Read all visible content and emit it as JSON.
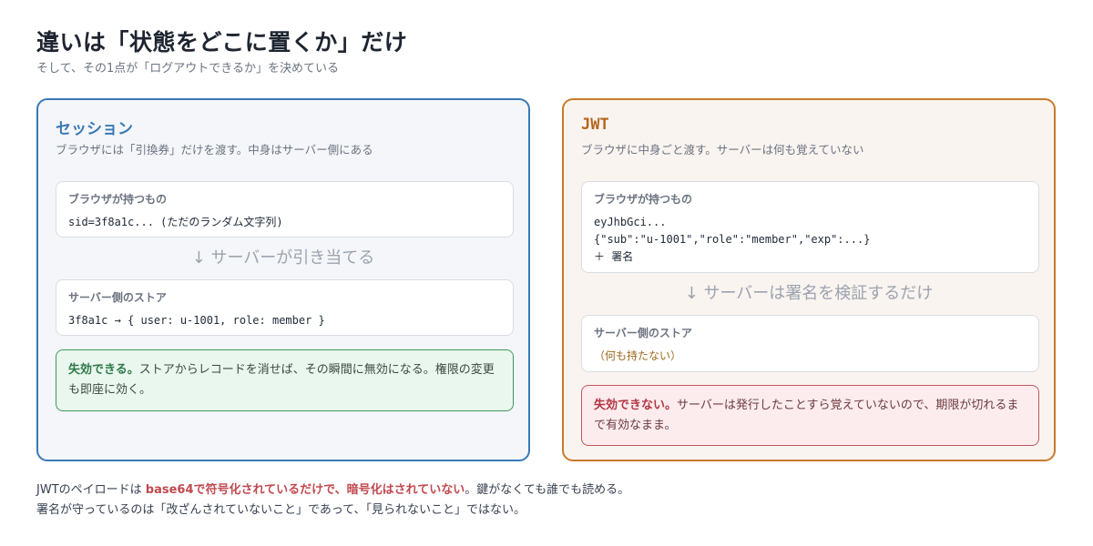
{
  "header": {
    "title": "違いは「状態をどこに置くか」だけ",
    "subtitle": "そして、その1点が「ログアウトできるか」を決めている"
  },
  "session": {
    "title": "セッション",
    "desc": "ブラウザには「引換券」だけを渡す。中身はサーバー側にある",
    "browser_label": "ブラウザが持つもの",
    "browser_value": "sid=3f8a1c... (ただのランダム文字列)",
    "arrow": "↓ サーバーが引き当てる",
    "store_label": "サーバー側のストア",
    "store_value": "3f8a1c → { user: u-1001, role: member }",
    "note_strong": "失効できる。",
    "note_text": "ストアからレコードを消せば、その瞬間に無効になる。権限の変更も即座に効く。"
  },
  "jwt": {
    "title": "JWT",
    "desc": "ブラウザに中身ごと渡す。サーバーは何も覚えていない",
    "browser_label": "ブラウザが持つもの",
    "browser_line1": "eyJhbGci...",
    "browser_line2": "{\"sub\":\"u-1001\",\"role\":\"member\",\"exp\":...}",
    "browser_line3": "＋ 署名",
    "arrow": "↓ サーバーは署名を検証するだけ",
    "store_label": "サーバー側のストア",
    "store_value": "（何も持たない）",
    "note_strong": "失効できない。",
    "note_text": "サーバーは発行したことすら覚えていないので、期限が切れるまで有効なまま。"
  },
  "footer": {
    "line1_a": "JWTのペイロードは ",
    "line1_em": "base64で符号化されているだけで、暗号化はされていない",
    "line1_b": "。鍵がなくても誰でも読める。",
    "line2": "署名が守っているのは「改ざんされていないこと」であって、「見られないこと」ではない。"
  },
  "colors": {
    "session_accent": "#3a78b5",
    "jwt_accent": "#c97a2c",
    "ok_green": "#3f9a5d",
    "ng_red": "#c1555f"
  }
}
